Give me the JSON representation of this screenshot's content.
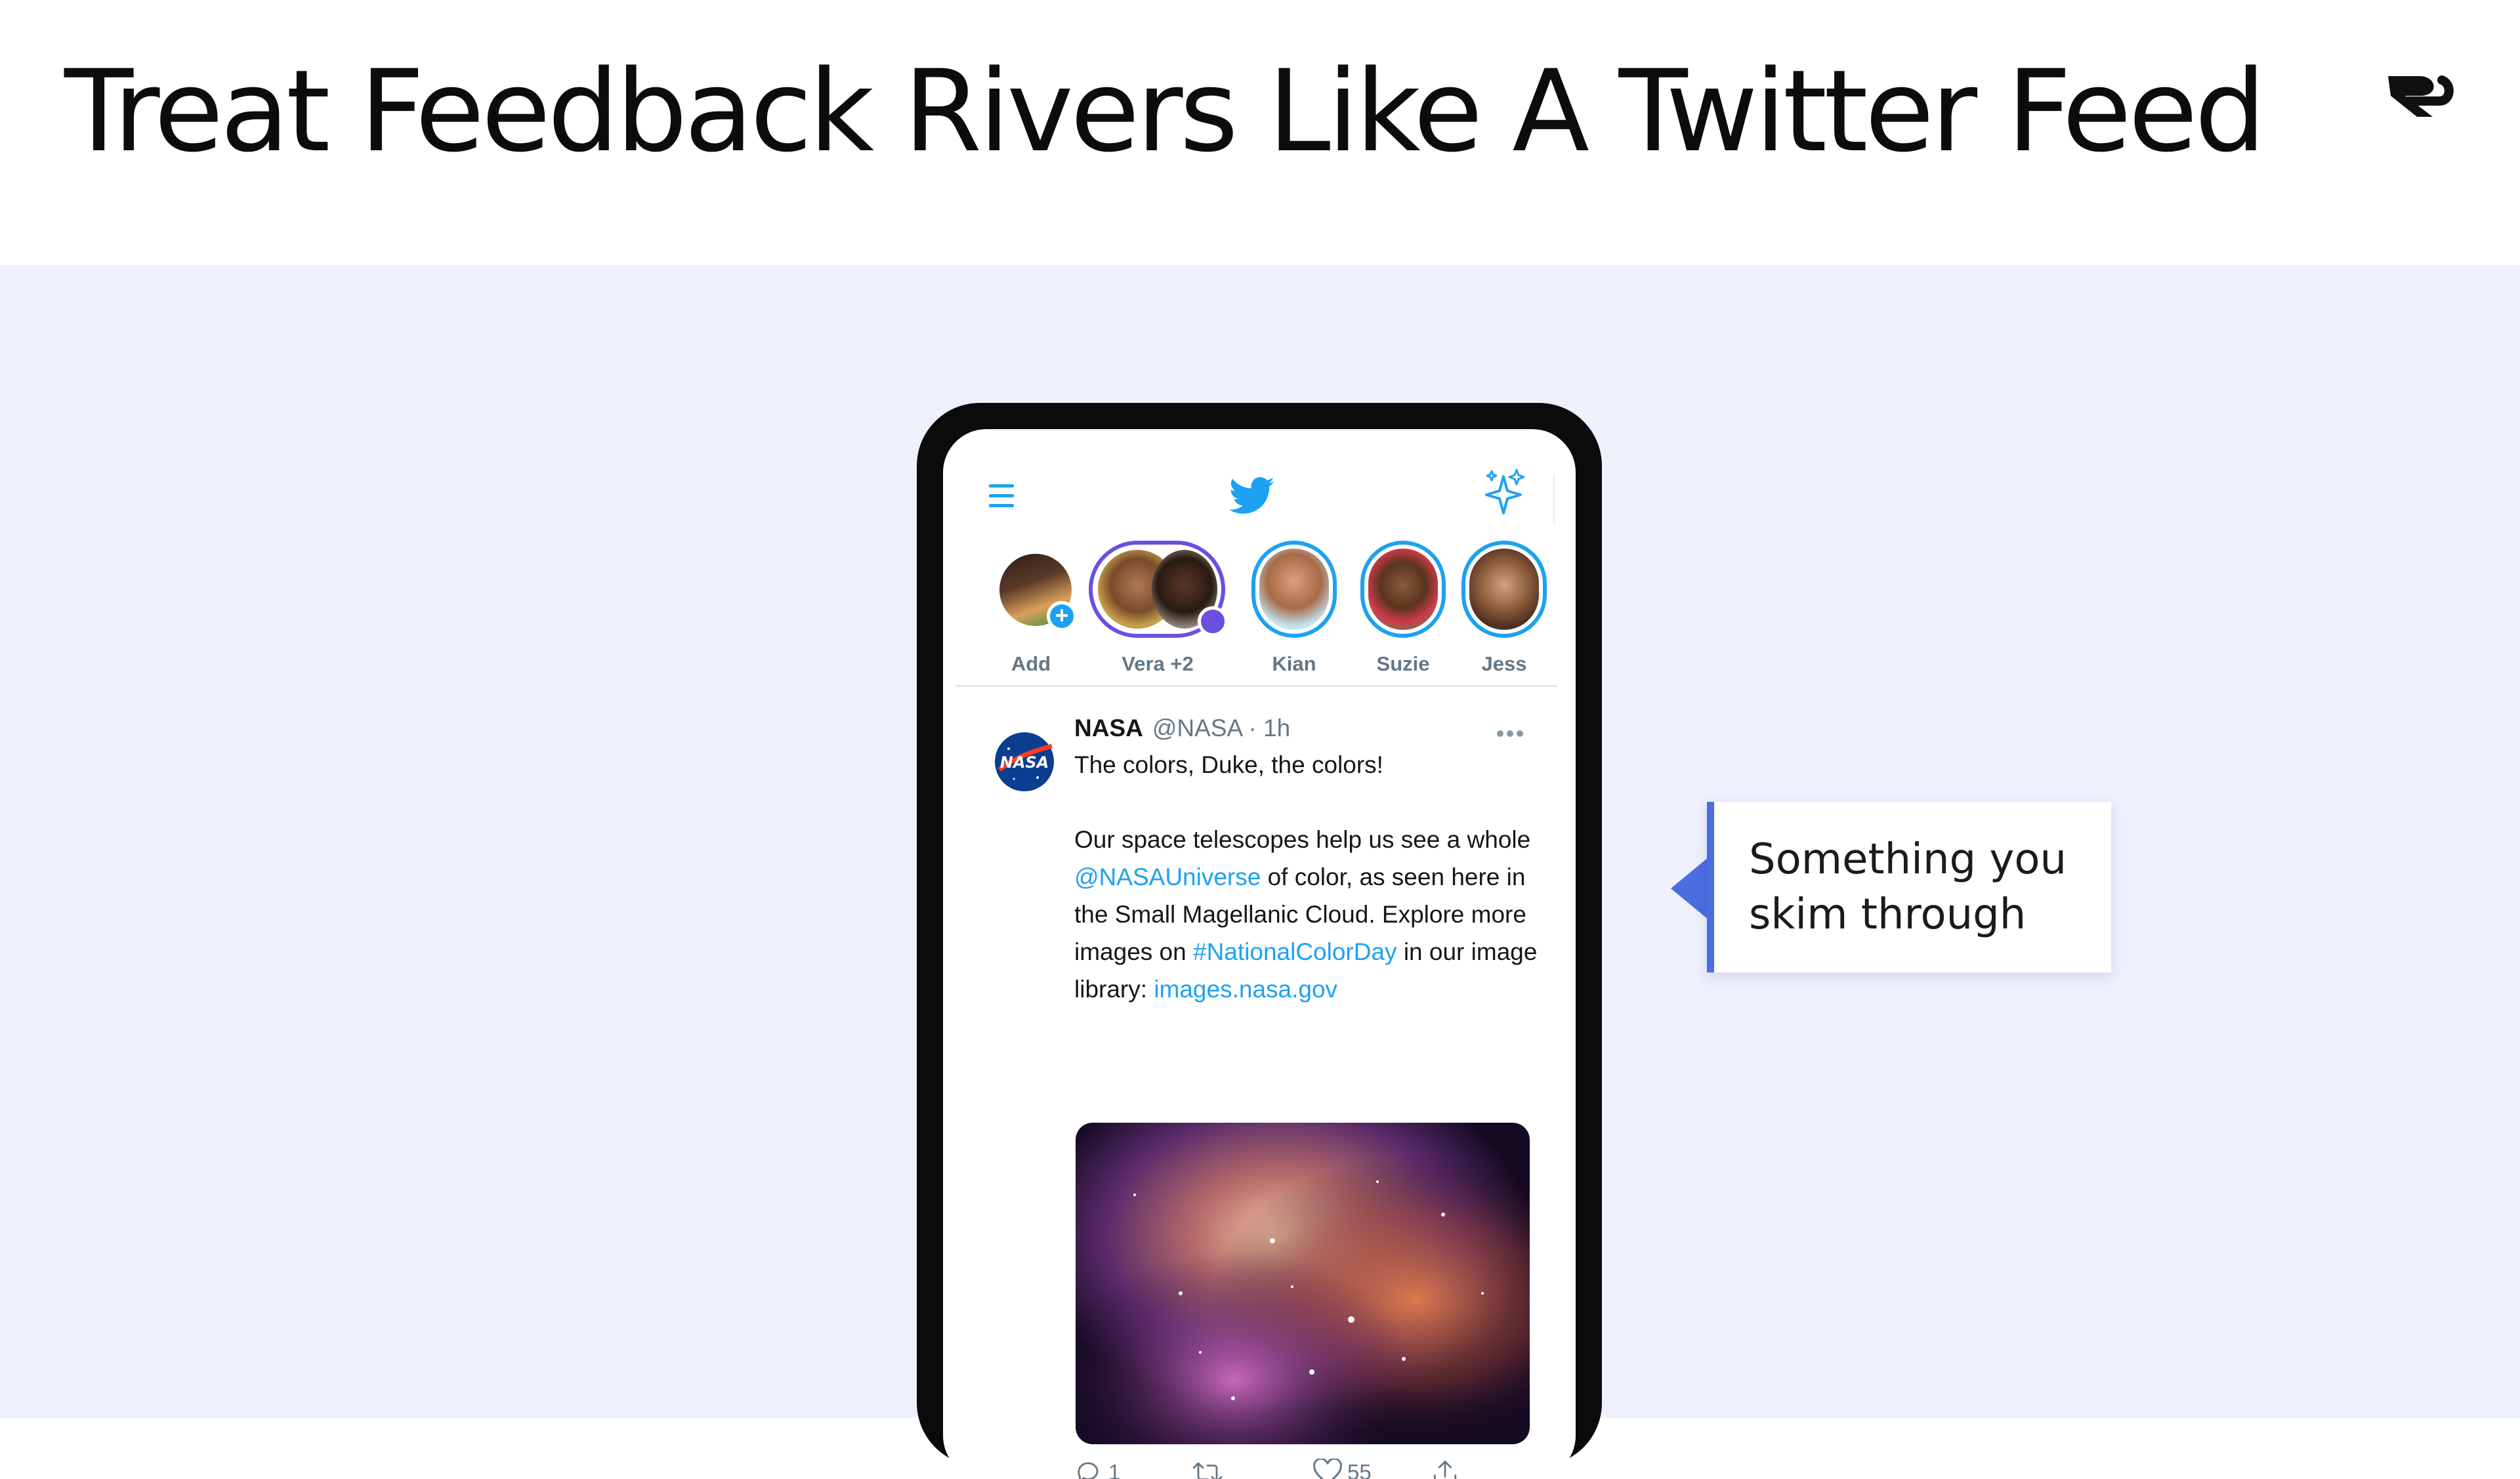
{
  "slide": {
    "title": "Treat Feedback Rivers Like A Twitter Feed",
    "logo_icon": "stacked-double-r-logo-icon"
  },
  "phone": {
    "topbar": {
      "menu_icon": "hamburger-menu-icon",
      "bird_icon": "twitter-bird-icon",
      "sparkle_icon": "sparkle-icon",
      "accent": "#1da1f2"
    },
    "fleets": [
      {
        "label": "Add"
      },
      {
        "label": "Vera +2"
      },
      {
        "label": "Kian"
      },
      {
        "label": "Suzie"
      },
      {
        "label": "Jess"
      }
    ],
    "tweet": {
      "name": "NASA",
      "handle": "@NASA",
      "time": " · 1h",
      "line1": "The colors, Duke, the colors!",
      "p2_a": "Our space telescopes help us see a whole",
      "mention": "@NASAUniverse",
      "p2_b": " of color, as seen here in the Small Magellanic Cloud. Explore more images on ",
      "hashtag": "#NationalColorDay",
      "p2_c": " in our image library: ",
      "url": "images.nasa.gov",
      "actions": {
        "reply_count": "1",
        "retweet_count": "",
        "like_count": "55"
      }
    }
  },
  "callout": {
    "text": "Something you skim through",
    "accent": "#4a6ee0"
  }
}
